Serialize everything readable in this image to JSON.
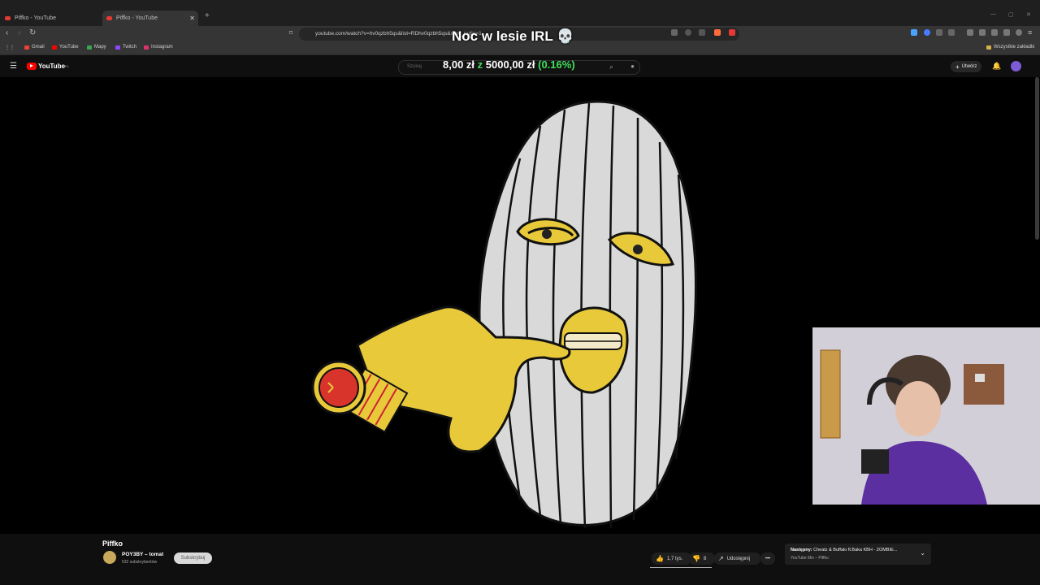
{
  "browser": {
    "tabs": [
      {
        "title": "Piffko - YouTube",
        "active": false
      },
      {
        "title": "Piffko - YouTube",
        "active": true
      }
    ],
    "new_tab": "+",
    "url": "youtube.com/watch?v=hv0qzbh5qs&list=RDhv0qzbh5qs&start_radio=1",
    "bookmarks": [
      {
        "label": "Gmail",
        "color": "#ea4335"
      },
      {
        "label": "YouTube",
        "color": "#ff0000"
      },
      {
        "label": "Mapy",
        "color": "#34a853"
      },
      {
        "label": "Twitch",
        "color": "#9146ff"
      },
      {
        "label": "Instagram",
        "color": "#e1306c"
      }
    ],
    "all_bookmarks": "Wszystkie zakładki"
  },
  "youtube": {
    "logo": "YouTube",
    "logo_region": "PL",
    "search_placeholder": "Szukaj",
    "create_label": "Utwórz"
  },
  "overlay": {
    "title": "Noc w lesie IRL 💀",
    "donation_current": "8,00 zł",
    "donation_sep": "z",
    "donation_goal": "5000,00 zł",
    "donation_pct": "(0.16%)"
  },
  "video": {
    "title": "Piffko",
    "channel": "POY3BY – tomat",
    "subscribers": "532 subskrybentów",
    "subscribe_label": "Subskrybuj",
    "likes": "1,7 tys.",
    "dislikes": "8",
    "share_label": "Udostępnij",
    "more": "•••"
  },
  "next_up": {
    "label": "Następny:",
    "title": "Cheatz & Buffalo ft.Baka KBH - ZOMBIE...",
    "subtitle": "YouTube Mix – Piffko"
  },
  "colors": {
    "mask": "#d9d9d9",
    "skin": "#e8c93a",
    "watch": "#d9342b",
    "accent_green": "#3ee05a"
  }
}
